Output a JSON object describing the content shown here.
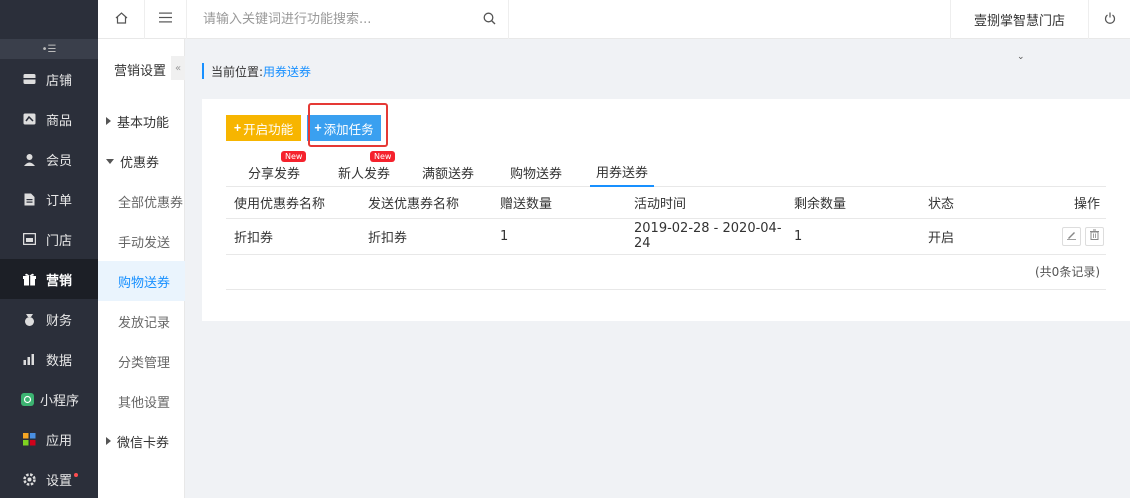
{
  "sidebar": {
    "items": [
      {
        "label": "店铺",
        "icon": "store-icon"
      },
      {
        "label": "商品",
        "icon": "goods-icon"
      },
      {
        "label": "会员",
        "icon": "member-icon"
      },
      {
        "label": "订单",
        "icon": "order-icon"
      },
      {
        "label": "门店",
        "icon": "shop-icon"
      },
      {
        "label": "营销",
        "icon": "gift-icon"
      },
      {
        "label": "财务",
        "icon": "finance-icon"
      },
      {
        "label": "数据",
        "icon": "chart-icon"
      },
      {
        "label": "小程序",
        "icon": "miniapp-icon"
      },
      {
        "label": "应用",
        "icon": "apps-icon"
      },
      {
        "label": "设置",
        "icon": "gear-icon"
      }
    ]
  },
  "submenu": {
    "title": "营销设置",
    "items": [
      {
        "label": "基本功能"
      },
      {
        "label": "优惠券"
      },
      {
        "label": "全部优惠券"
      },
      {
        "label": "手动发送"
      },
      {
        "label": "购物送券"
      },
      {
        "label": "发放记录"
      },
      {
        "label": "分类管理"
      },
      {
        "label": "其他设置"
      },
      {
        "label": "微信卡券"
      }
    ]
  },
  "topbar": {
    "search_placeholder": "请输入关键词进行功能搜索...",
    "store_name": "壹捌掌智慧门店"
  },
  "breadcrumb": {
    "prefix": "当前位置:",
    "current": "用券送券"
  },
  "actions": {
    "open_label": "开启功能",
    "add_label": "添加任务"
  },
  "tabs": [
    {
      "label": "分享发券",
      "badge": "New"
    },
    {
      "label": "新人发券",
      "badge": "New"
    },
    {
      "label": "满额送券"
    },
    {
      "label": "购物送券"
    },
    {
      "label": "用券送券"
    }
  ],
  "table": {
    "headers": [
      "使用优惠券名称",
      "发送优惠券名称",
      "赠送数量",
      "活动时间",
      "剩余数量",
      "状态",
      "操作"
    ],
    "rows": [
      [
        "折扣券",
        "折扣券",
        "1",
        "2019-02-28 - 2020-04-24",
        "1",
        "开启"
      ]
    ],
    "footer": "(共0条记录)"
  },
  "colors": {
    "accent": "#1890ff",
    "open_button": "#f7b500",
    "add_button": "#3aa0f0",
    "highlight": "#e53935",
    "sidebar_bg": "#2b2f3a"
  }
}
